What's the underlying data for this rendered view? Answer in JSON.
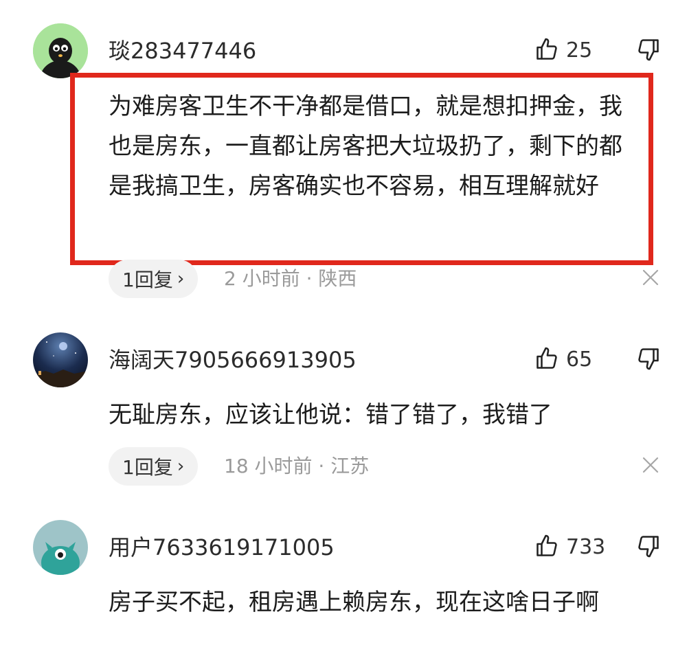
{
  "comments": [
    {
      "username": "琰283477446",
      "likes": "25",
      "text": "为难房客卫生不干净都是借口，就是想扣押金，我也是房东，一直都让房客把大垃圾扔了，剩下的都是我搞卫生，房客确实也不容易，相互理解就好",
      "reply_label": "1回复",
      "meta": "2 小时前 · 陕西"
    },
    {
      "username": "海阔天7905666913905",
      "likes": "65",
      "text": "无耻房东，应该让他说：错了错了，我错了",
      "reply_label": "1回复",
      "meta": "18 小时前 · 江苏"
    },
    {
      "username": "用户7633619171005",
      "likes": "733",
      "text": "房子买不起，租房遇上赖房东，现在这啥日子啊"
    }
  ],
  "icons": {
    "like": "thumbs-up-outline",
    "dislike": "thumbs-down-outline",
    "close": "close-x",
    "chevron": "chevron-right"
  },
  "colors": {
    "highlight": "#e0281c",
    "meta_text": "#9a9a9a",
    "pill_bg": "#f2f2f2"
  }
}
